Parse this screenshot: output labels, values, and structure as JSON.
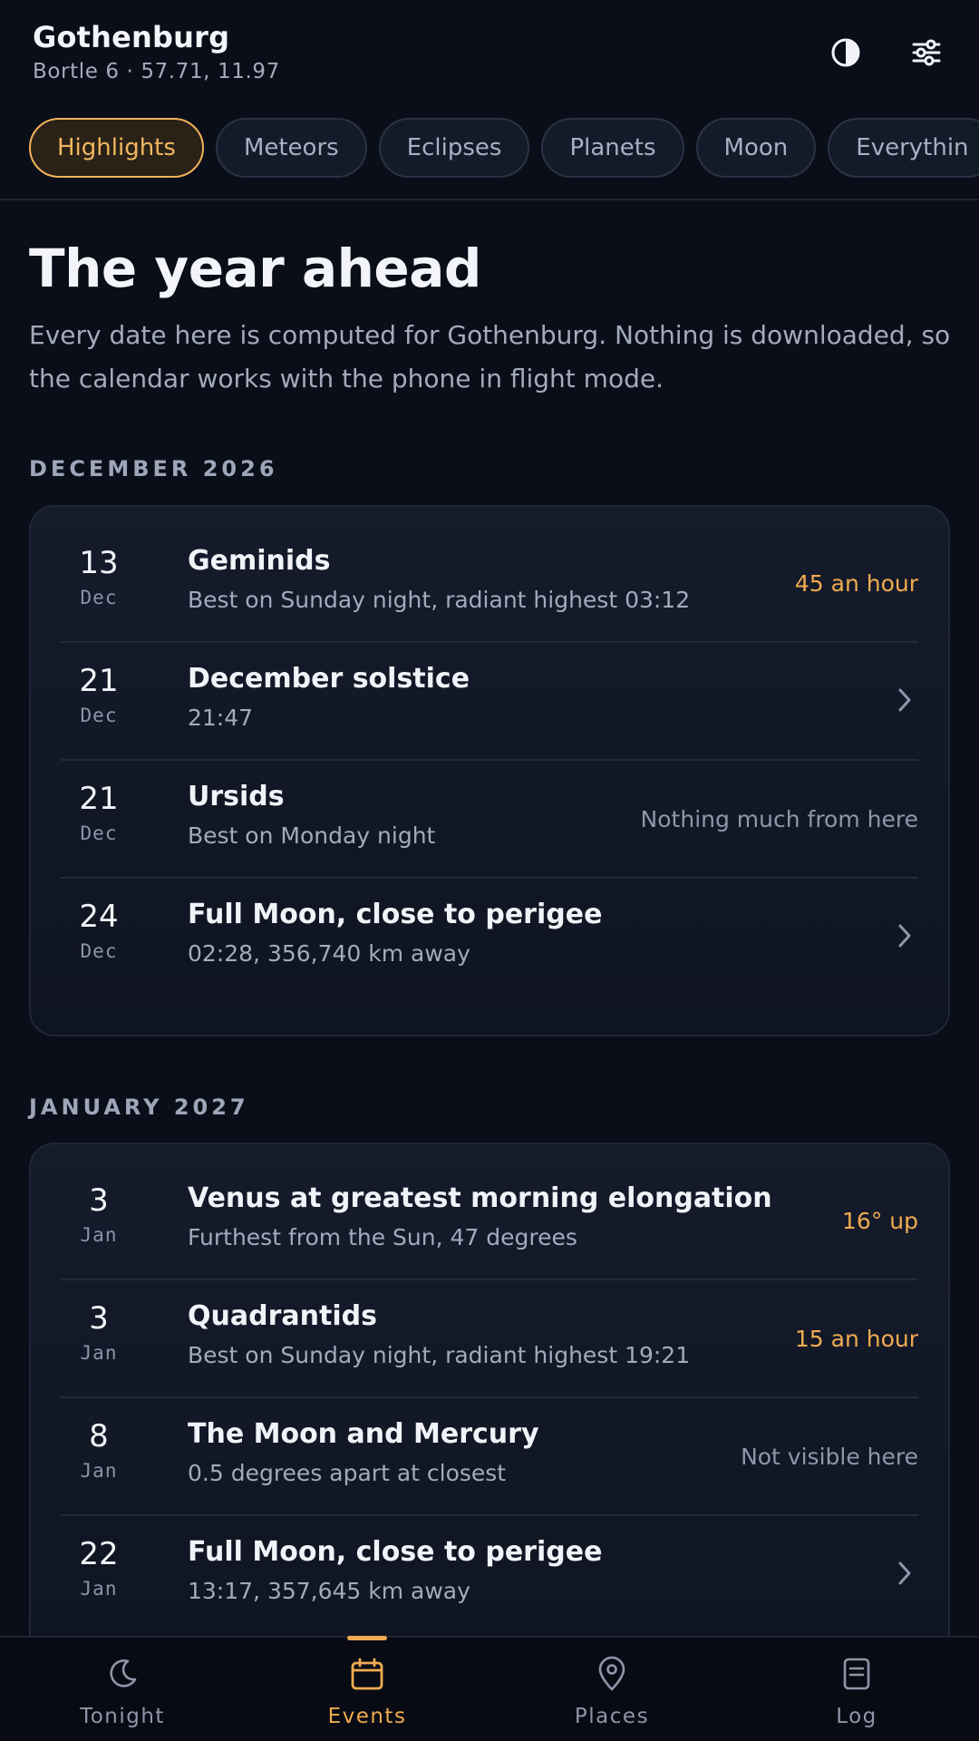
{
  "header": {
    "city": "Gothenburg",
    "location_line": "Bortle 6 · 57.71, 11.97",
    "contrast_icon": "contrast-icon",
    "filter_icon": "sliders-icon"
  },
  "chips": [
    {
      "label": "Highlights",
      "active": true
    },
    {
      "label": "Meteors",
      "active": false
    },
    {
      "label": "Eclipses",
      "active": false
    },
    {
      "label": "Planets",
      "active": false
    },
    {
      "label": "Moon",
      "active": false
    },
    {
      "label": "Everythin",
      "active": false
    }
  ],
  "intro": {
    "title": "The year ahead",
    "body": "Every date here is computed for Gothenburg. Nothing is downloaded, so the calendar works with the phone in flight mode."
  },
  "months": [
    {
      "label": "DECEMBER 2026",
      "events": [
        {
          "day": "13",
          "month": "Dec",
          "title": "Geminids",
          "subtitle": "Best on Sunday night, radiant highest 03:12",
          "badge": "45 an hour",
          "badge_style": "warm"
        },
        {
          "day": "21",
          "month": "Dec",
          "title": "December solstice",
          "subtitle": "21:47",
          "badge": "",
          "badge_style": "chevron"
        },
        {
          "day": "21",
          "month": "Dec",
          "title": "Ursids",
          "subtitle": "Best on Monday night",
          "badge": "Nothing much from here",
          "badge_style": "muted"
        },
        {
          "day": "24",
          "month": "Dec",
          "title": "Full Moon, close to perigee",
          "subtitle": "02:28, 356,740 km away",
          "badge": "",
          "badge_style": "chevron"
        }
      ]
    },
    {
      "label": "JANUARY 2027",
      "events": [
        {
          "day": "3",
          "month": "Jan",
          "title": "Venus at greatest morning elongation",
          "subtitle": "Furthest from the Sun, 47 degrees",
          "badge": "16° up",
          "badge_style": "warm"
        },
        {
          "day": "3",
          "month": "Jan",
          "title": "Quadrantids",
          "subtitle": "Best on Sunday night, radiant highest 19:21",
          "badge": "15 an hour",
          "badge_style": "warm"
        },
        {
          "day": "8",
          "month": "Jan",
          "title": "The Moon and Mercury",
          "subtitle": "0.5 degrees apart at closest",
          "badge": "Not visible here",
          "badge_style": "muted"
        },
        {
          "day": "22",
          "month": "Jan",
          "title": "Full Moon, close to perigee",
          "subtitle": "13:17, 357,645 km away",
          "badge": "",
          "badge_style": "chevron"
        }
      ]
    }
  ],
  "bottom_nav": [
    {
      "label": "Tonight",
      "icon": "moon-icon",
      "active": false
    },
    {
      "label": "Events",
      "icon": "calendar-icon",
      "active": true
    },
    {
      "label": "Places",
      "icon": "map-pin-icon",
      "active": false
    },
    {
      "label": "Log",
      "icon": "notebook-icon",
      "active": false
    }
  ],
  "colors": {
    "background": "#0a0e19",
    "accent": "#f0ab50",
    "muted_text": "#8e97aa"
  }
}
